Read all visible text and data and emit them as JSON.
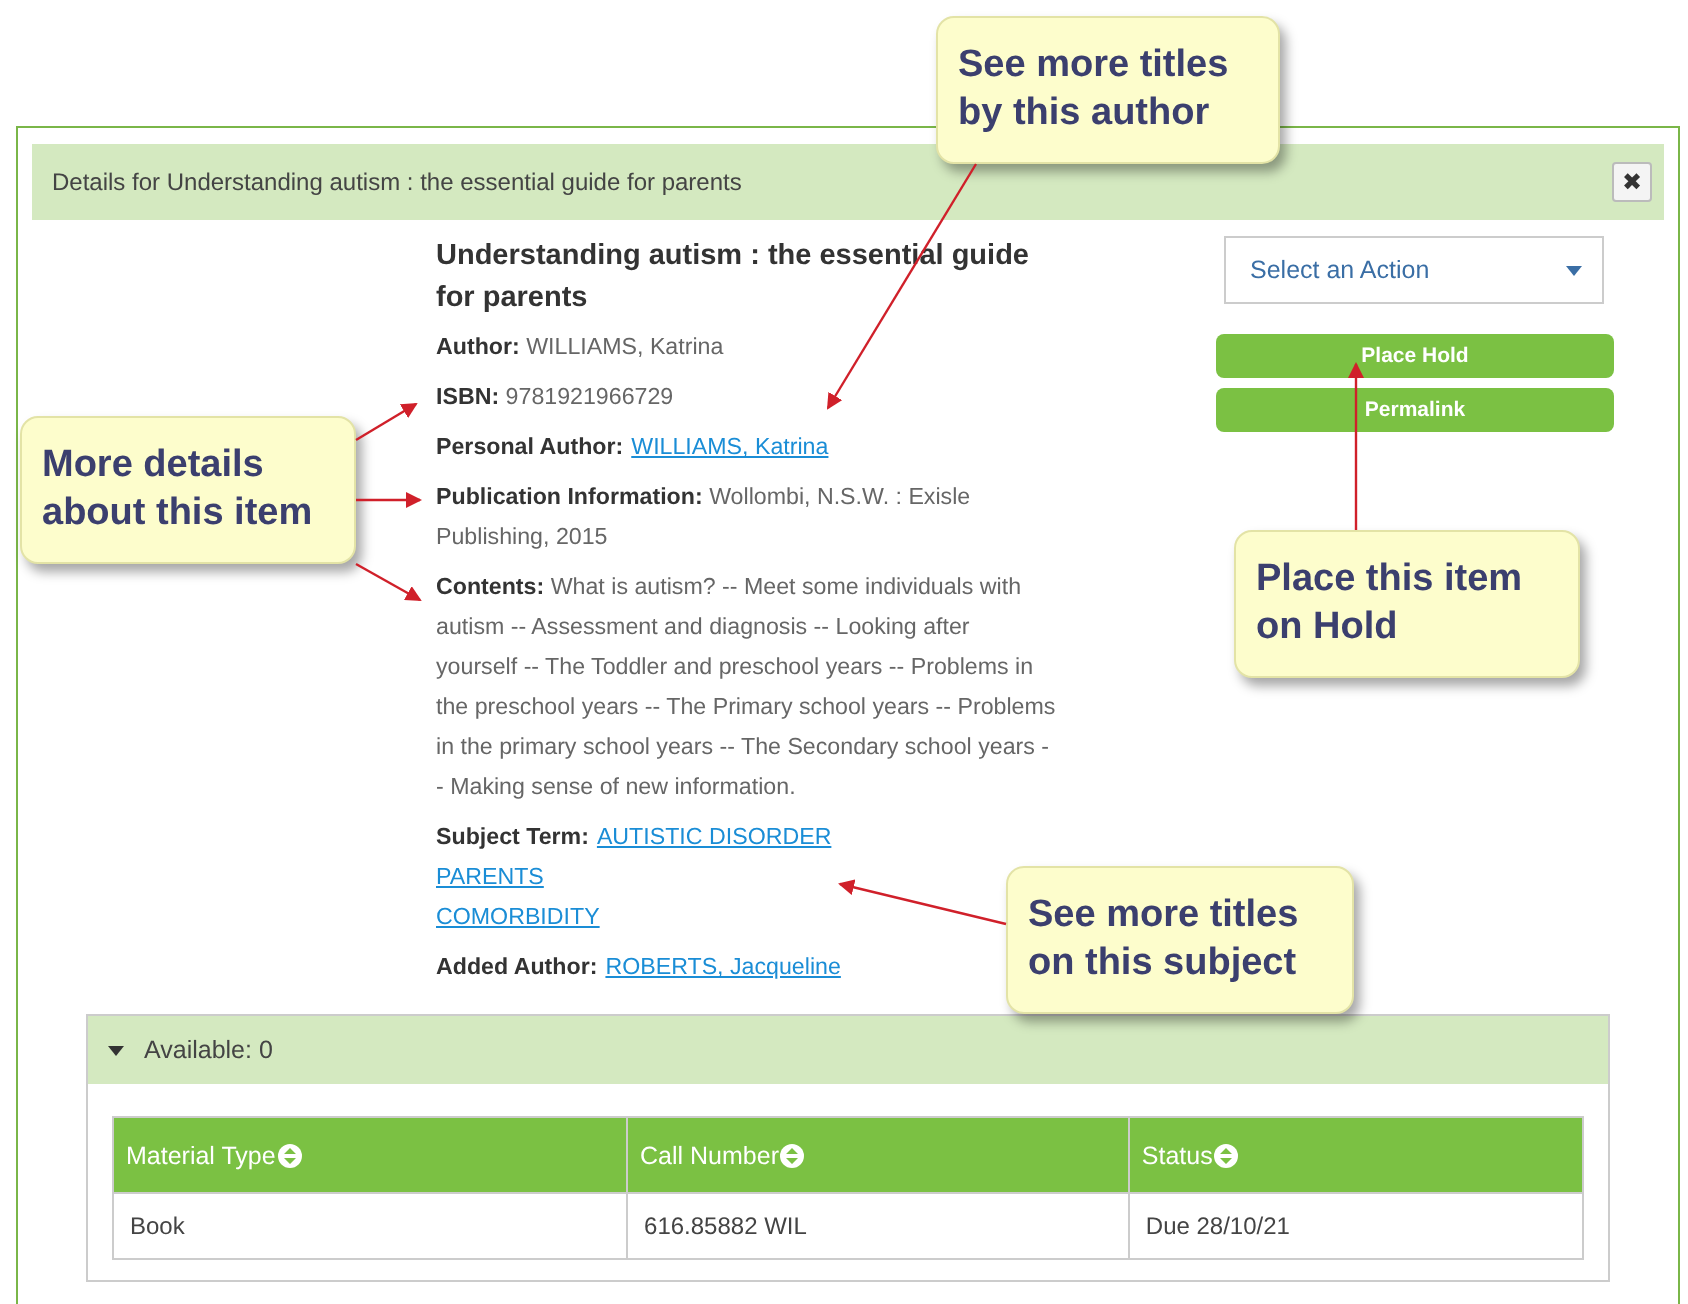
{
  "dialog": {
    "title": "Details for Understanding autism : the essential guide for parents",
    "close": "✖"
  },
  "record": {
    "title": "Understanding autism : the essential guide for parents",
    "fields": [
      {
        "kind": "text",
        "label": "Author:",
        "value": "WILLIAMS, Katrina"
      },
      {
        "kind": "text",
        "label": "ISBN:",
        "value": "9781921966729"
      },
      {
        "kind": "link",
        "label": "Personal Author:",
        "links": [
          "WILLIAMS, Katrina"
        ]
      },
      {
        "kind": "text",
        "label": "Publication Information:",
        "value": "Wollombi, N.S.W. : Exisle Publishing, 2015"
      },
      {
        "kind": "text",
        "label": "Contents:",
        "value": "What is autism? -- Meet some individuals with autism -- Assessment and diagnosis -- Looking after yourself -- The Toddler and preschool years -- Problems in the preschool years -- The Primary school years -- Problems in the primary school years -- The Secondary school years -- Making sense of new information."
      },
      {
        "kind": "link",
        "label": "Subject Term:",
        "links": [
          "AUTISTIC DISORDER",
          "PARENTS",
          "COMORBIDITY"
        ]
      },
      {
        "kind": "link",
        "label": "Added Author:",
        "links": [
          "ROBERTS, Jacqueline"
        ]
      }
    ]
  },
  "actions": {
    "placeholder": "Select an Action",
    "buttons": [
      "Place Hold",
      "Permalink"
    ]
  },
  "availability": {
    "label": "Available: 0",
    "expanded": true,
    "table": {
      "columns": [
        "Material Type",
        "Call Number",
        "Status"
      ],
      "rows": [
        [
          "Book",
          "616.85882 WIL",
          "Due 28/10/21"
        ]
      ]
    }
  },
  "callouts": [
    {
      "text": "See more titles by this author"
    },
    {
      "text": "More details about this item"
    },
    {
      "text": "Place this item on Hold"
    },
    {
      "text": "See more titles on this subject"
    }
  ]
}
